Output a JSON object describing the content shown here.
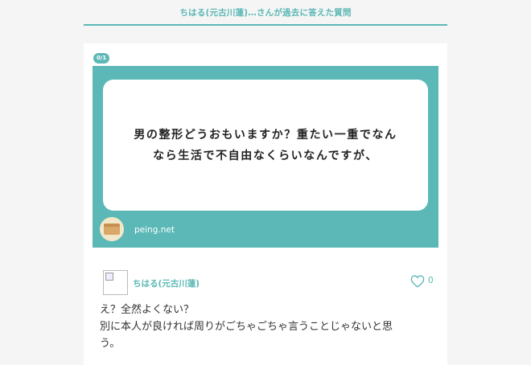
{
  "header": {
    "title": "ちはる(元古川蓮)…さんが過去に答えた質問"
  },
  "question_card": {
    "badge": "0/1",
    "question_text": "男の整形どうおもいますか？重たい一重でなん\nなら生活で不自由なくらいなんですが、",
    "source_label": "peing.net"
  },
  "answer": {
    "answerer_name": "ちはる(元古川蓮)",
    "like_count": "0",
    "text": "え？全然よくない？\n別に本人が良ければ周りがごちゃごちゃ言うことじゃないと思\nう。"
  },
  "colors": {
    "accent": "#5bb8b6",
    "panel": "#5cb8b7",
    "background": "#f5f5f5"
  }
}
